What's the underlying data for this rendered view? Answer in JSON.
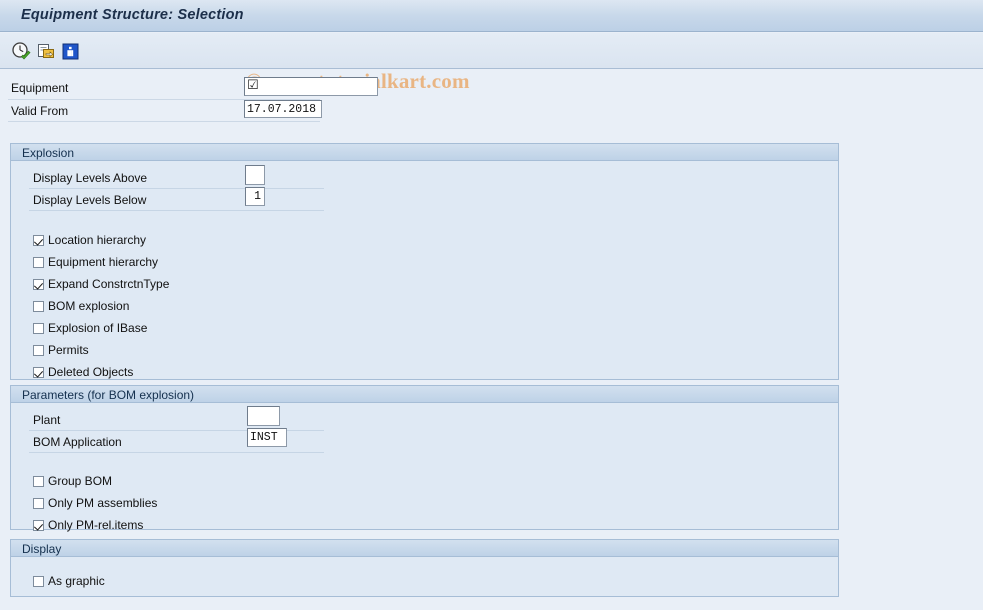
{
  "window": {
    "title": "Equipment Structure: Selection"
  },
  "watermark": {
    "text": "© www.tutorialkart.com",
    "color": "#e9b583"
  },
  "toolbar": {
    "buttons": [
      {
        "name": "execute-clock-check-icon",
        "tooltip": "Execute"
      },
      {
        "name": "multiple-selection-icon",
        "tooltip": "Multiple Selection"
      },
      {
        "name": "information-icon",
        "tooltip": "Information"
      }
    ]
  },
  "header_fields": [
    {
      "label": "Equipment",
      "value": "",
      "placeholder": "",
      "cursor_glyph": "☑"
    },
    {
      "label": "Valid From",
      "value": "17.07.2018",
      "placeholder": ""
    }
  ],
  "sections": [
    {
      "id": "explosion",
      "title": "Explosion",
      "fields": [
        {
          "label": "Display Levels Above",
          "value": ""
        },
        {
          "label": "Display Levels Below",
          "value": "1"
        }
      ],
      "checkboxes": [
        {
          "label": "Location hierarchy",
          "checked": true
        },
        {
          "label": "Equipment hierarchy",
          "checked": false
        },
        {
          "label": "Expand ConstrctnType",
          "checked": true
        },
        {
          "label": "BOM explosion",
          "checked": false
        },
        {
          "label": "Explosion of IBase",
          "checked": false
        },
        {
          "label": "Permits",
          "checked": false
        },
        {
          "label": "Deleted Objects",
          "checked": true
        }
      ]
    },
    {
      "id": "parameters",
      "title": "Parameters (for BOM explosion)",
      "fields": [
        {
          "label": "Plant",
          "value": ""
        },
        {
          "label": "BOM Application",
          "value": "INST"
        }
      ],
      "checkboxes": [
        {
          "label": "Group BOM",
          "checked": false
        },
        {
          "label": "Only PM assemblies",
          "checked": false
        },
        {
          "label": "Only PM-rel.items",
          "checked": true
        }
      ]
    },
    {
      "id": "display",
      "title": "Display",
      "fields": [],
      "checkboxes": [
        {
          "label": "As graphic",
          "checked": false
        }
      ]
    }
  ]
}
